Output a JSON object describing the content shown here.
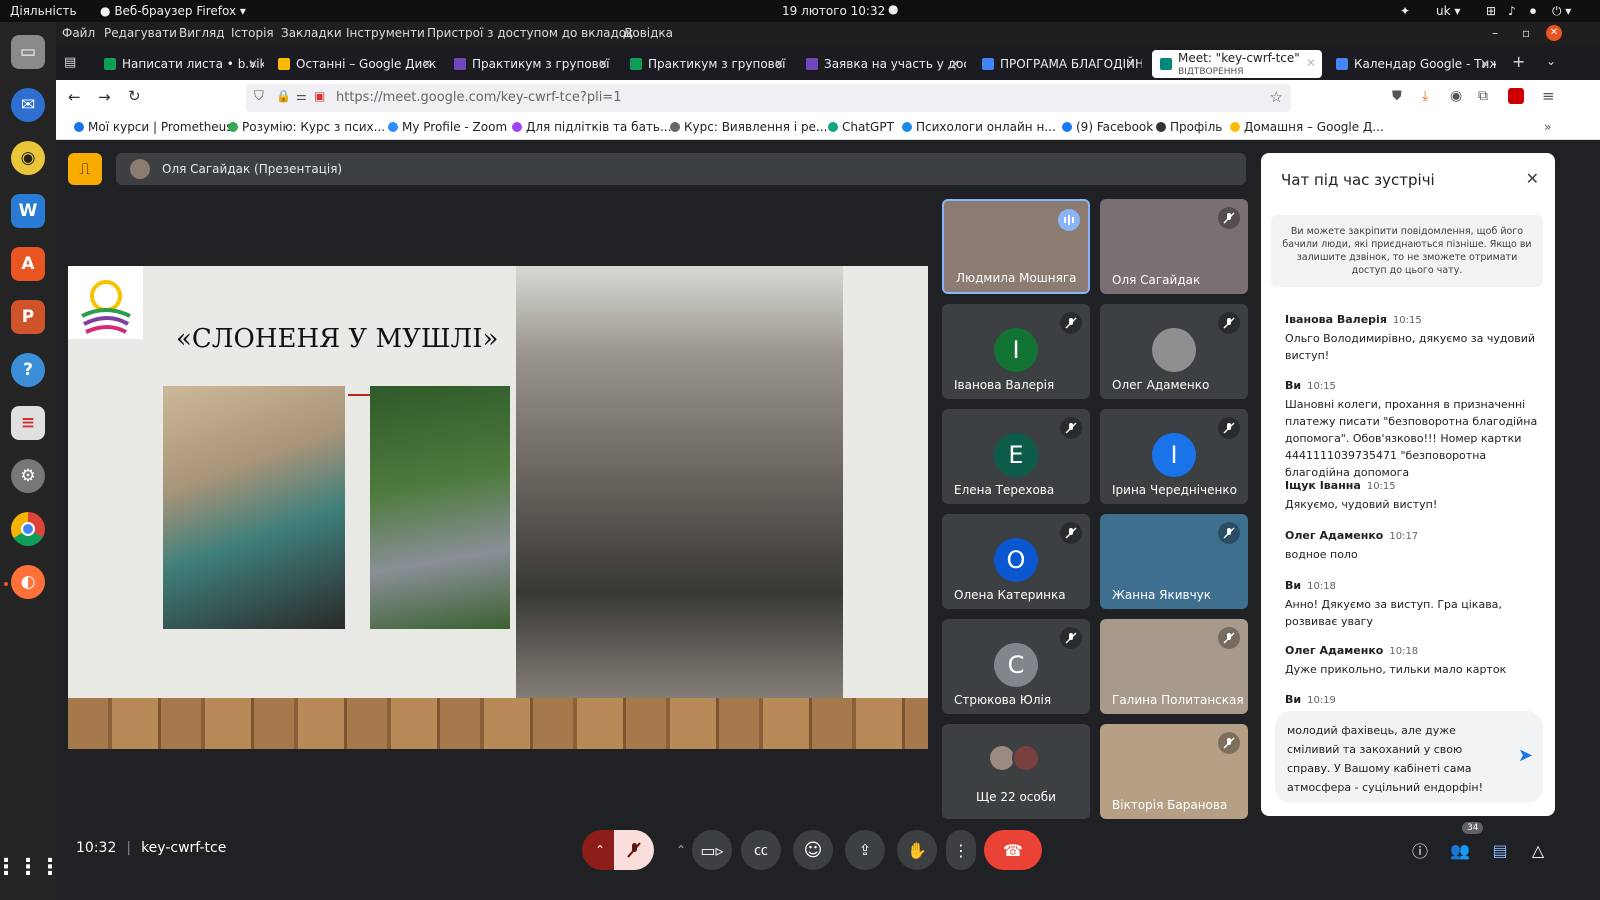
{
  "topbar": {
    "activities": "Діяльність",
    "app": "Веб-браузер Firefox ▾",
    "datetime": "19 лютого  10:32",
    "lang": "uk ▾"
  },
  "menubar": {
    "items": [
      "Файл",
      "Редагувати",
      "Вигляд",
      "Історія",
      "Закладки",
      "Інструменти",
      "Пристрої з доступом до вкладок",
      "Довідка"
    ]
  },
  "tabs": [
    {
      "label": "Написати листа • b.vikt",
      "color": "#0f9d58"
    },
    {
      "label": "Останні – Google Диск",
      "color": "#fbbc04"
    },
    {
      "label": "Практикум з групової р",
      "color": "#7248b9"
    },
    {
      "label": "Практикум з групової р",
      "color": "#0f9d58"
    },
    {
      "label": "Заявка на участь у дос",
      "color": "#7248b9"
    },
    {
      "label": "ПРОГРАМА БЛАГОДІЙН",
      "color": "#4285f4"
    },
    {
      "label": "Meet: \"key-cwrf-tce\"",
      "sub": "ВІДТВОРЕННЯ",
      "color": "#00897b"
    },
    {
      "label": "Календар Google - Тиж",
      "color": "#4285f4"
    }
  ],
  "url": "https://meet.google.com/key-cwrf-tce?pli=1",
  "bookmarks": [
    {
      "label": "Мої курси | Prometheus",
      "color": "#1a73e8"
    },
    {
      "label": "Розумію: Курс з псих...",
      "color": "#34a853"
    },
    {
      "label": "My Profile - Zoom",
      "color": "#2d8cff"
    },
    {
      "label": "Для підлітків та бать...",
      "color": "#a142f4"
    },
    {
      "label": "Курс: Виявлення і ре...",
      "color": "#666666"
    },
    {
      "label": "ChatGPT",
      "color": "#10a37f"
    },
    {
      "label": "Психологи онлайн н...",
      "color": "#1e88e5"
    },
    {
      "label": "(9) Facebook",
      "color": "#1877f2"
    },
    {
      "label": "Профіль",
      "color": "#333333"
    },
    {
      "label": "Домашня – Google Д...",
      "color": "#fbbc04"
    }
  ],
  "presenter": "Оля Сагайдак (Презентація)",
  "slide": {
    "title": "«СЛОНЕНЯ У МУШЛІ»"
  },
  "participants": [
    {
      "name": "Людмила Мошняга",
      "kind": "video",
      "speaking": true,
      "bg": "#8b7b70"
    },
    {
      "name": "Оля Сагайдак",
      "kind": "video",
      "bg": "#7a6f74"
    },
    {
      "name": "Іванова Валерія",
      "initial": "І",
      "color": "#137333"
    },
    {
      "name": "Олег Адаменко",
      "kind": "photo",
      "bg": "#8d8f91"
    },
    {
      "name": "Елена Терехова",
      "initial": "Е",
      "color": "#0d5c4a"
    },
    {
      "name": "Ірина Чередніченко",
      "initial": "І",
      "color": "#1a73e8"
    },
    {
      "name": "Олена Катеринка",
      "initial": "О",
      "color": "#0b57d0"
    },
    {
      "name": "Жанна Якивчук",
      "kind": "video",
      "bg": "#3e6f8f"
    },
    {
      "name": "Стрюкова Юлія",
      "initial": "С",
      "color": "#80868b"
    },
    {
      "name": "Галина Политанская",
      "kind": "video",
      "bg": "#a89a8a"
    },
    {
      "name": "Ще 22 особи",
      "kind": "more"
    },
    {
      "name": "Вікторія Баранова",
      "kind": "video",
      "bg": "#b59f85"
    }
  ],
  "chat": {
    "title": "Чат під час зустрічі",
    "notice": "Ви можете закріпити повідомлення, щоб його бачили люди, які приєднаються пізніше. Якщо ви залишите дзвінок, то не зможете отримати доступ до цього чату.",
    "messages": [
      {
        "author": "Іванова Валерія",
        "time": "10:15",
        "text": "Ольго Володимирівно, дякуємо за чудовий виступ!"
      },
      {
        "author": "Ви",
        "time": "10:15",
        "text": "Шановні колеги, прохання в призначенні платежу писати \"безповоротна благодійна допомога\". Обов'язково!!! Номер картки 4441111039735471 \"безповоротна благодійна допомога"
      },
      {
        "author": "Іщук Іванна",
        "time": "10:15",
        "text": "Дякуємо, чудовий виступ!"
      },
      {
        "author": "Олег Адаменко",
        "time": "10:17",
        "text": "водное поло"
      },
      {
        "author": "Ви",
        "time": "10:18",
        "text": "Анно! Дякуємо за виступ. Гра цікава, розвиває увагу"
      },
      {
        "author": "Олег Адаменко",
        "time": "10:18",
        "text": "Дуже прикольно, тильки мало карток"
      },
      {
        "author": "Ви",
        "time": "10:19",
        "text": ""
      }
    ],
    "draft": "молодий фахівець, але дуже сміливий та закоханий у свою справу. У Вашому кабінеті сама атмосфера - суцільний ендорфін!"
  },
  "footer": {
    "time": "10:32",
    "code": "key-cwrf-tce",
    "people_count": "34"
  }
}
